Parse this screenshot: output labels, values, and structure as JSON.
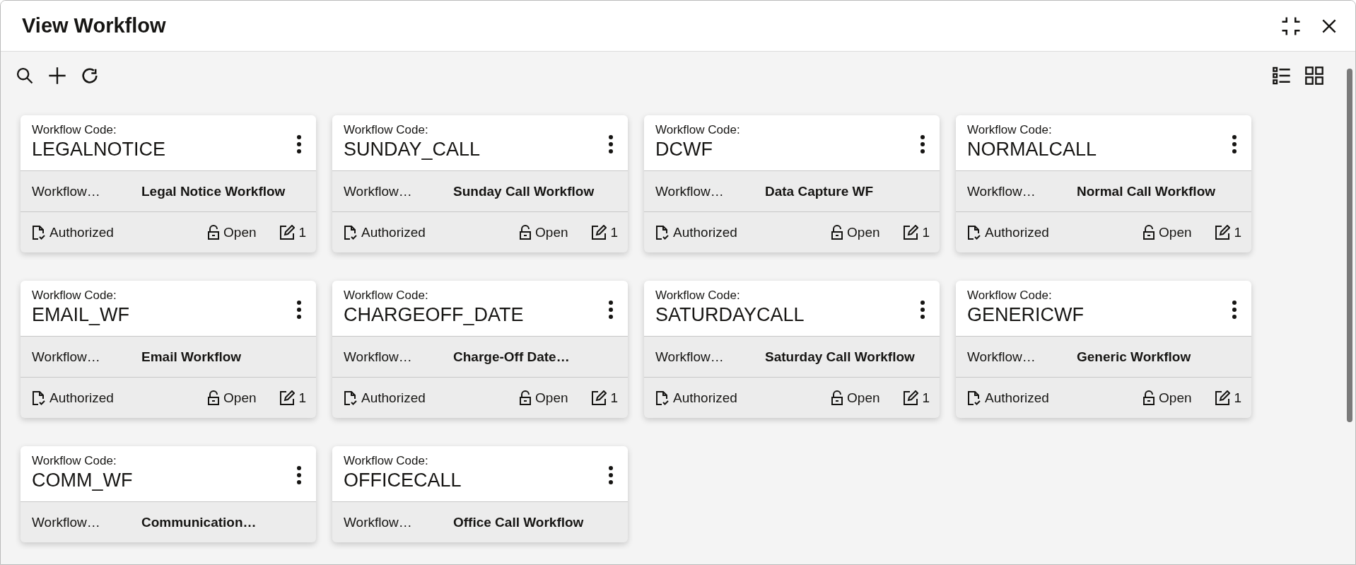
{
  "window": {
    "title": "View Workflow"
  },
  "cards": [
    {
      "code_label": "Workflow Code:",
      "code": "LEGALNOTICE",
      "name_label": "Workflow…",
      "name": "Legal Notice Workflow",
      "auth_status": "Authorized",
      "record_status": "Open",
      "modifications": "1"
    },
    {
      "code_label": "Workflow Code:",
      "code": "SUNDAY_CALL",
      "name_label": "Workflow…",
      "name": "Sunday Call Workflow",
      "auth_status": "Authorized",
      "record_status": "Open",
      "modifications": "1"
    },
    {
      "code_label": "Workflow Code:",
      "code": "DCWF",
      "name_label": "Workflow…",
      "name": "Data Capture WF",
      "auth_status": "Authorized",
      "record_status": "Open",
      "modifications": "1"
    },
    {
      "code_label": "Workflow Code:",
      "code": "NORMALCALL",
      "name_label": "Workflow…",
      "name": "Normal Call Workflow",
      "auth_status": "Authorized",
      "record_status": "Open",
      "modifications": "1"
    },
    {
      "code_label": "Workflow Code:",
      "code": "EMAIL_WF",
      "name_label": "Workflow…",
      "name": "Email Workflow",
      "auth_status": "Authorized",
      "record_status": "Open",
      "modifications": "1"
    },
    {
      "code_label": "Workflow Code:",
      "code": "CHARGEOFF_DATE",
      "name_label": "Workflow…",
      "name": "Charge-Off Date…",
      "auth_status": "Authorized",
      "record_status": "Open",
      "modifications": "1"
    },
    {
      "code_label": "Workflow Code:",
      "code": "SATURDAYCALL",
      "name_label": "Workflow…",
      "name": "Saturday Call Workflow",
      "auth_status": "Authorized",
      "record_status": "Open",
      "modifications": "1"
    },
    {
      "code_label": "Workflow Code:",
      "code": "GENERICWF",
      "name_label": "Workflow…",
      "name": "Generic Workflow",
      "auth_status": "Authorized",
      "record_status": "Open",
      "modifications": "1"
    },
    {
      "code_label": "Workflow Code:",
      "code": "COMM_WF",
      "name_label": "Workflow…",
      "name": "Communication…"
    },
    {
      "code_label": "Workflow Code:",
      "code": "OFFICECALL",
      "name_label": "Workflow…",
      "name": "Office Call Workflow"
    }
  ]
}
